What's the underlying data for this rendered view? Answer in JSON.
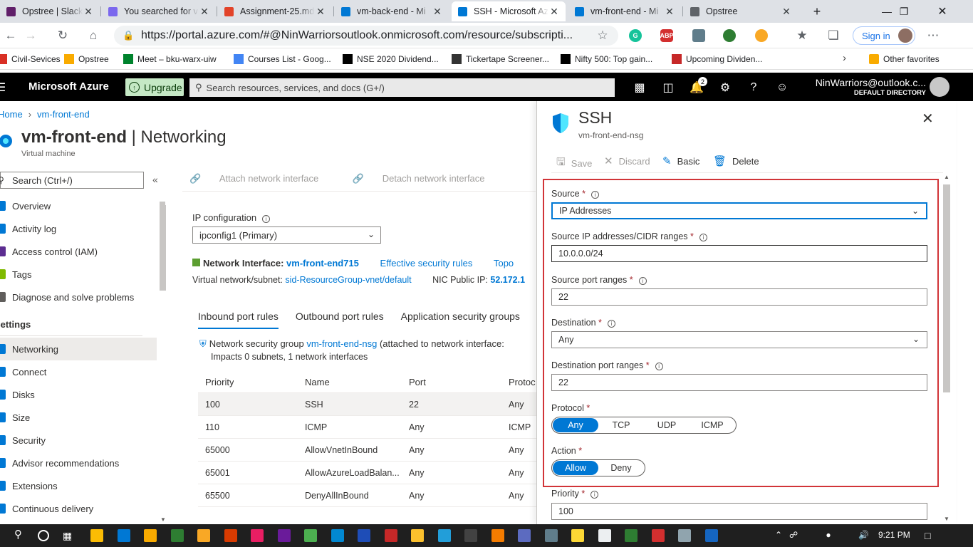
{
  "browser": {
    "tabs": [
      {
        "title": "Opstree | Slack",
        "icon": "slack-icon",
        "color": "#611f69"
      },
      {
        "title": "You searched for v",
        "icon": "clickup-icon",
        "color": "#7b68ee"
      },
      {
        "title": "Assignment-25.md",
        "icon": "gitlab-icon",
        "color": "#e24329"
      },
      {
        "title": "vm-back-end - Mi",
        "icon": "azure-icon",
        "color": "#0078d4"
      },
      {
        "title": "SSH - Microsoft Az",
        "icon": "azure-icon",
        "color": "#0078d4",
        "active": true
      },
      {
        "title": "vm-front-end - Mi",
        "icon": "azure-icon",
        "color": "#0078d4"
      },
      {
        "title": "Opstree",
        "icon": "page-icon",
        "color": "#5f6368"
      }
    ],
    "url": "https://portal.azure.com/#@NinWarriorsoutlook.onmicrosoft.com/resource/subscripti...",
    "sign_in": "Sign in",
    "bookmarks": [
      {
        "label": "Civil-Sevices",
        "color": "#d93025"
      },
      {
        "label": "Opstree",
        "color": "#f9ab00"
      },
      {
        "label": "Meet – bku-warx-uiw",
        "color": "#00832d"
      },
      {
        "label": "Courses List - Goog...",
        "color": "#4285f4"
      },
      {
        "label": "NSE 2020 Dividend...",
        "color": "#000000"
      },
      {
        "label": "Tickertape Screener...",
        "color": "#333333"
      },
      {
        "label": "Nifty 500: Top gain...",
        "color": "#000000"
      },
      {
        "label": "Upcoming Dividen...",
        "color": "#c62828"
      }
    ],
    "other_favorites": "Other favorites"
  },
  "azure": {
    "brand": "Microsoft Azure",
    "upgrade": "Upgrade",
    "search_placeholder": "Search resources, services, and docs (G+/)",
    "notif_count": "2",
    "account_email": "NinWarriors@outlook.c...",
    "account_dir": "DEFAULT DIRECTORY"
  },
  "page": {
    "breadcrumb_home": "Home",
    "breadcrumb_vm": "vm-front-end",
    "title_bold": "vm-front-end",
    "title_rest": " | Networking",
    "subtitle": "Virtual machine",
    "side_search": "Search (Ctrl+/)",
    "side_items": [
      "Overview",
      "Activity log",
      "Access control (IAM)",
      "Tags",
      "Diagnose and solve problems"
    ],
    "side_group": "Settings",
    "side_settings": [
      "Networking",
      "Connect",
      "Disks",
      "Size",
      "Security",
      "Advisor recommendations",
      "Extensions",
      "Continuous delivery"
    ],
    "attach_nic": "Attach network interface",
    "detach_nic": "Detach network interface",
    "ip_config_label": "IP configuration",
    "ip_config_value": "ipconfig1 (Primary)",
    "nic_label": "Network Interface:",
    "nic_name": "vm-front-end715",
    "effective_rules": "Effective security rules",
    "topology": "Topo",
    "vnet_label": "Virtual network/subnet:",
    "vnet_value": "sid-ResourceGroup-vnet/default",
    "public_ip_label": "NIC Public IP:",
    "public_ip_value": "52.172.1",
    "tabs": [
      "Inbound port rules",
      "Outbound port rules",
      "Application security groups"
    ],
    "nsg_prefix": "Network security group",
    "nsg_name": "vm-front-end-nsg",
    "nsg_suffix": "(attached to network interface:",
    "nsg_impacts": "Impacts 0 subnets, 1 network interfaces",
    "table_headers": [
      "Priority",
      "Name",
      "Port",
      "Protoc"
    ],
    "rules": [
      [
        "100",
        "SSH",
        "22",
        "Any"
      ],
      [
        "110",
        "ICMP",
        "Any",
        "ICMP"
      ],
      [
        "65000",
        "AllowVnetInBound",
        "Any",
        "Any"
      ],
      [
        "65001",
        "AllowAzureLoadBalan...",
        "Any",
        "Any"
      ],
      [
        "65500",
        "DenyAllInBound",
        "Any",
        "Any"
      ]
    ]
  },
  "panel": {
    "title": "SSH",
    "subtitle": "vm-front-end-nsg",
    "save": "Save",
    "discard": "Discard",
    "basic": "Basic",
    "delete": "Delete",
    "source_label": "Source",
    "source_value": "IP Addresses",
    "src_ip_label": "Source IP addresses/CIDR ranges",
    "src_ip_value": "10.0.0.0/24",
    "src_port_label": "Source port ranges",
    "src_port_value": "22",
    "dest_label": "Destination",
    "dest_value": "Any",
    "dest_port_label": "Destination port ranges",
    "dest_port_value": "22",
    "protocol_label": "Protocol",
    "protocols": [
      "Any",
      "TCP",
      "UDP",
      "ICMP"
    ],
    "protocol_selected": "Any",
    "action_label": "Action",
    "actions": [
      "Allow",
      "Deny"
    ],
    "action_selected": "Allow",
    "priority_label": "Priority",
    "priority_value": "100",
    "required_mark": "*",
    "info_mark": "i"
  },
  "taskbar": {
    "time": "9:21 PM"
  }
}
